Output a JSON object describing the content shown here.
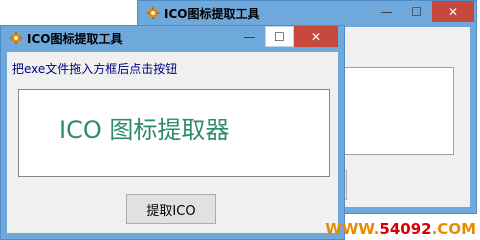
{
  "back_window": {
    "title": "ICO图标提取工具",
    "min_glyph": "—",
    "max_glyph": "☐",
    "close_glyph": "✕"
  },
  "front_window": {
    "title": "ICO图标提取工具",
    "min_glyph": "—",
    "max_glyph": "☐",
    "close_glyph": "✕",
    "instruction": "把exe文件拖入方框后点击按钮",
    "display_text": "ICO 图标提取器",
    "extract_button": "提取ICO"
  },
  "watermark": {
    "part1": "WWW.",
    "part2": "54092",
    "part3": ".COM"
  },
  "colors": {
    "frame": "#6fa8da",
    "close_button": "#c7483d",
    "display_text": "#2e8b6b"
  }
}
